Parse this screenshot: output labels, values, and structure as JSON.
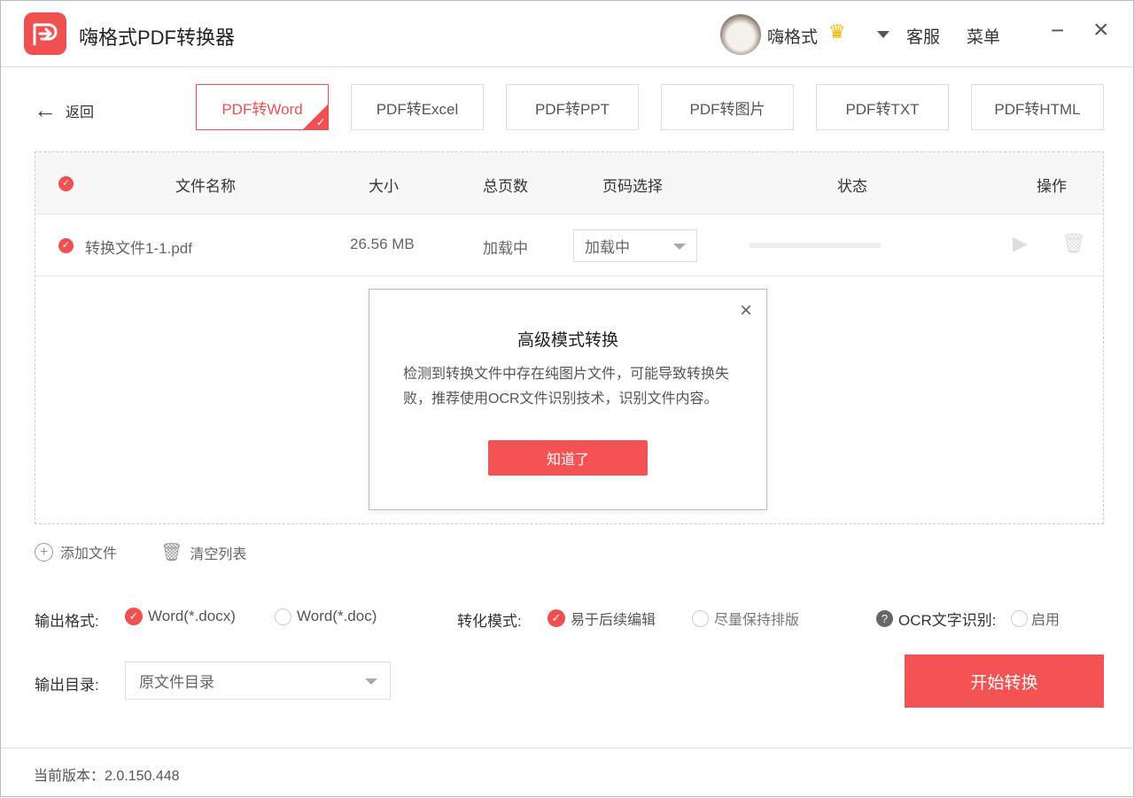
{
  "app": {
    "title": "嗨格式PDF转换器",
    "user": "嗨格式",
    "support": "客服",
    "menu": "菜单",
    "minimize": "−",
    "close": "×"
  },
  "nav": {
    "back": "返回",
    "tabs": [
      "PDF转Word",
      "PDF转Excel",
      "PDF转PPT",
      "PDF转图片",
      "PDF转TXT",
      "PDF转HTML"
    ]
  },
  "table": {
    "headers": {
      "name": "文件名称",
      "size": "大小",
      "pages": "总页数",
      "range": "页码选择",
      "status": "状态",
      "action": "操作"
    },
    "rows": [
      {
        "name": "转换文件1-1.pdf",
        "size": "26.56 MB",
        "pages": "加载中",
        "range": "加载中",
        "progress": 0
      }
    ]
  },
  "modal": {
    "title": "高级模式转换",
    "body": "检测到转换文件中存在纯图片文件，可能导致转换失败，推荐使用OCR文件识别技术，识别文件内容。",
    "ok": "知道了"
  },
  "actions": {
    "add": "添加文件",
    "clear": "清空列表"
  },
  "options": {
    "format_label": "输出格式:",
    "format_docx": "Word(*.docx)",
    "format_doc": "Word(*.doc)",
    "mode_label": "转化模式:",
    "mode_edit": "易于后续编辑",
    "mode_layout": "尽量保持排版",
    "ocr_label": "OCR文字识别:",
    "ocr_enable": "启用",
    "dir_label": "输出目录:",
    "dir_value": "原文件目录"
  },
  "start": "开始转换",
  "version": "当前版本：2.0.150.448",
  "colors": {
    "accent": "#f05050"
  }
}
